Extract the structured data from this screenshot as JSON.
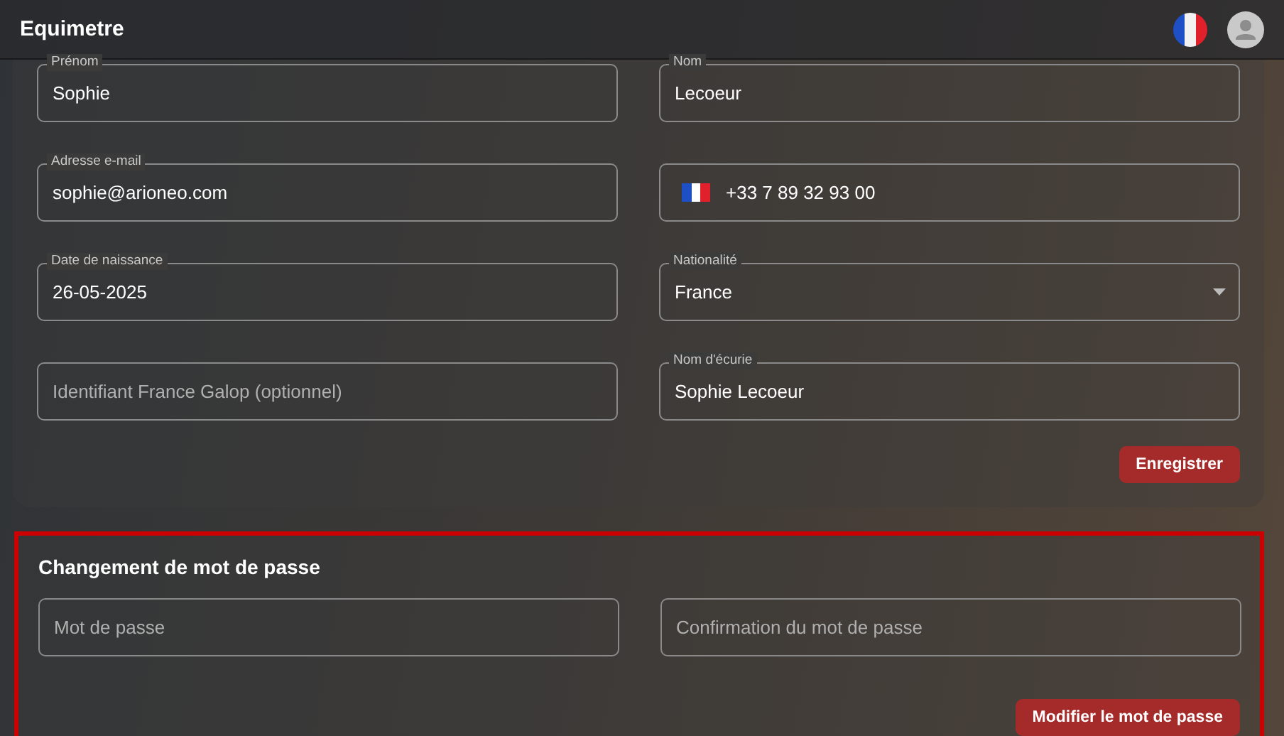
{
  "header": {
    "title": "Equimetre"
  },
  "profile_form": {
    "fields": [
      {
        "kind": "text",
        "label": "Prénom",
        "value": "Sophie"
      },
      {
        "kind": "text",
        "label": "Nom",
        "value": "Lecoeur"
      },
      {
        "kind": "text",
        "label": "Adresse e-mail",
        "value": "sophie@arioneo.com"
      },
      {
        "kind": "phone",
        "value": "+33 7 89 32 93 00"
      },
      {
        "kind": "text",
        "label": "Date de naissance",
        "value": "26-05-2025"
      },
      {
        "kind": "select",
        "label": "Nationalité",
        "value": "France"
      },
      {
        "kind": "text",
        "placeholder": "Identifiant France Galop (optionnel)"
      },
      {
        "kind": "text",
        "label": "Nom d'écurie",
        "value": "Sophie Lecoeur"
      }
    ],
    "save_button": "Enregistrer"
  },
  "password_section": {
    "title": "Changement de mot de passe",
    "highlighted": true,
    "fields": [
      {
        "kind": "password",
        "placeholder": "Mot de passe"
      },
      {
        "kind": "password",
        "placeholder": "Confirmation du mot de passe"
      }
    ],
    "submit_button": "Modifier le mot de passe"
  }
}
